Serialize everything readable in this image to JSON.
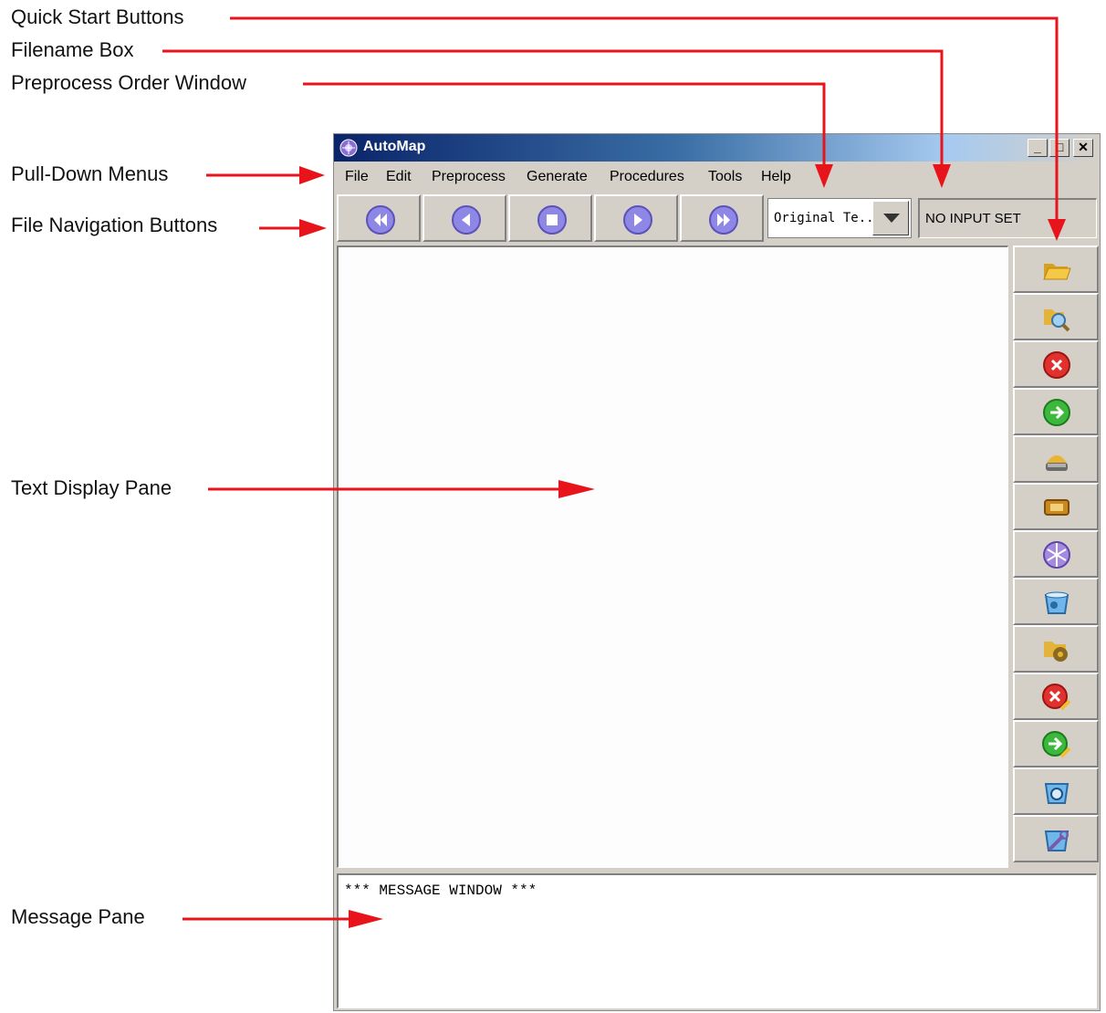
{
  "callouts": {
    "quick_start": "Quick Start Buttons",
    "filename_box": "Filename Box",
    "preprocess_order": "Preprocess Order Window",
    "pull_down_menus": "Pull-Down Menus",
    "file_nav": "File Navigation Buttons",
    "text_display": "Text Display Pane",
    "message_pane": "Message Pane"
  },
  "colors": {
    "arrow": "#e8141b",
    "title_gradient_start": "#0a246a",
    "window_bg": "#d4d0c8"
  },
  "window": {
    "title": "AutoMap",
    "controls": {
      "minimize": "_",
      "maximize": "□",
      "close": "✕"
    }
  },
  "menu": [
    "File",
    "Edit",
    "Preprocess",
    "Generate",
    "Procedures",
    "Tools",
    "Help"
  ],
  "nav_buttons": [
    "first-icon",
    "previous-icon",
    "stop-icon",
    "next-icon",
    "last-icon"
  ],
  "preprocess_order": {
    "value": "Original Te..."
  },
  "filename": {
    "value": "NO INPUT SET"
  },
  "quick_start_buttons": [
    "open-folder-icon",
    "search-folder-icon",
    "close-red-icon",
    "run-green-icon",
    "database-icon",
    "chip-icon",
    "network-icon",
    "cup-icon",
    "folder-gear-icon",
    "delete-edit-icon",
    "run-edit-icon",
    "cup-search-icon",
    "tools-icon"
  ],
  "message_window": {
    "text": "*** MESSAGE WINDOW ***"
  }
}
